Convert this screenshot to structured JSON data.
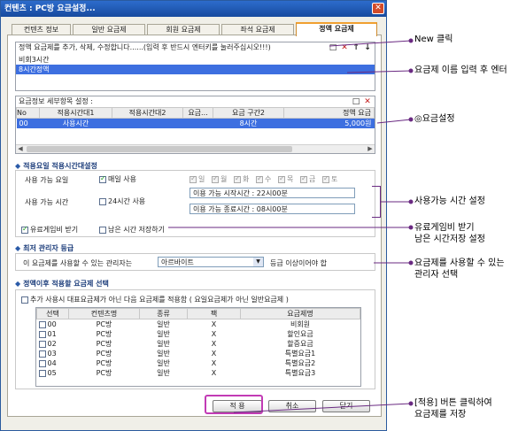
{
  "window": {
    "title": "컨텐츠 : PC방 요금설정...",
    "close": "✕"
  },
  "tabs": [
    "컨텐츠 정보",
    "일반 요금제",
    "회원 요금제",
    "좌석 요금제",
    "정액 요금제"
  ],
  "plan_list": {
    "instruction": "정액 요금제를 추가, 삭제, 수정합니다......(입력 후 반드시 엔터키를 눌러주십시오!!!)",
    "items": [
      "비회3시간",
      "8시간정액"
    ],
    "selected_index": 1,
    "tools": {
      "new": "□",
      "delete": "✕",
      "up": "↑",
      "down": "↓"
    }
  },
  "detail": {
    "header": "요금정보 세부항목 설정 :",
    "columns": [
      "No",
      "적용시간대1",
      "적용시간대2",
      "요금...",
      "요금 구간2",
      "정액 요금"
    ],
    "row": [
      "00",
      "사용시간",
      "",
      "",
      "8시간",
      "5,000원"
    ]
  },
  "time_section": {
    "title": "적용요일 적용시간대설정",
    "day_label": "사용 가능 요일",
    "everyday_label": "매일 사용",
    "days": [
      "일",
      "월",
      "화",
      "수",
      "목",
      "금",
      "토"
    ],
    "time_label": "사용 가능 시간",
    "allday_label": "24시간 사용",
    "start_label": "이용 가능 시작시간 :",
    "start_value": "22시00분",
    "end_label": "이용 가능 종료시간 :",
    "end_value": "08시00분",
    "paid_game_label": "유료게임비 받기",
    "save_remaining_label": "남은 시간 저장하기"
  },
  "admin_section": {
    "title": "최저 관리자 등급",
    "prefix": "이 요금제를 사용할 수 있는 관리자는",
    "selected": "아르바이트",
    "suffix": "등급 이상이어야 합"
  },
  "after_section": {
    "title": "정액이후 적용할 요금제 선택",
    "option_label": "추가 사용시 대표요금제가 아닌 다음 요금제를 적용함 ( 요일요금제가 아닌 일반요금제 )",
    "columns": [
      "선택",
      "컨텐츠명",
      "종류",
      "팩",
      "요금제명"
    ],
    "rows": [
      [
        "00",
        "PC방",
        "일반",
        "X",
        "비회원"
      ],
      [
        "01",
        "PC방",
        "일반",
        "X",
        "할인요금"
      ],
      [
        "02",
        "PC방",
        "일반",
        "X",
        "할증요금"
      ],
      [
        "03",
        "PC방",
        "일반",
        "X",
        "특별요금1"
      ],
      [
        "04",
        "PC방",
        "일반",
        "X",
        "특별요금2"
      ],
      [
        "05",
        "PC방",
        "일반",
        "X",
        "특별요금3"
      ]
    ]
  },
  "buttons": {
    "apply": "적 용",
    "cancel": "취소",
    "close": "닫기"
  },
  "annotations": {
    "new_click": "New 클릭",
    "name_enter": "요금제 이름 입력 후 엔터",
    "fee_setting": "◎요금설정",
    "time_setting": "사용가능 시간 설정",
    "paid_game_1": "유료게임비 받기",
    "paid_game_2": "남은 시간저장 설정",
    "admin_1": "요금제를 사용할 수 있는",
    "admin_2": "관리자 선택",
    "apply_1": "[적용] 버튼 클릭하여",
    "apply_2": "요금제를 저장"
  },
  "colors": {
    "accent": "#3d6fe0",
    "highlight": "#c23bb5",
    "titlebar": "#1f5bb8"
  }
}
